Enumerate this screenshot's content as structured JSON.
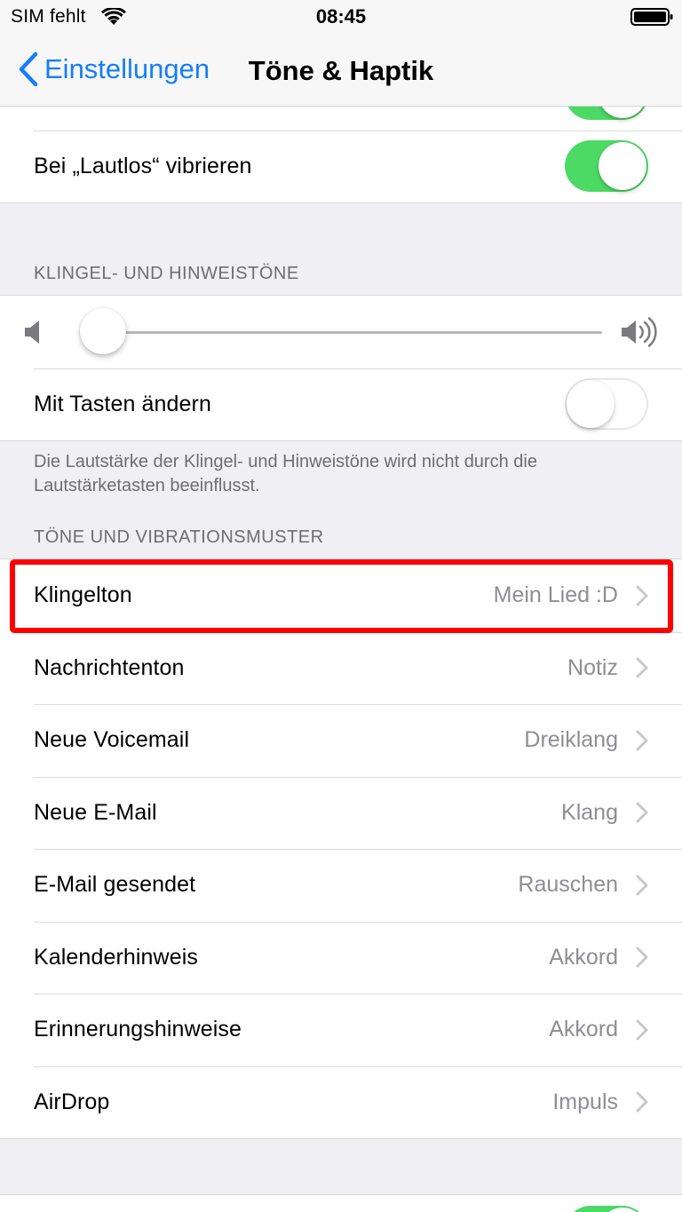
{
  "status_bar": {
    "carrier": "SIM fehlt",
    "time": "08:45"
  },
  "nav": {
    "back_label": "Einstellungen",
    "title": "Töne & Haptik"
  },
  "top_group": {
    "partial_row_toggle": "on",
    "vibrate_silent": {
      "label": "Bei „Lautlos“ vibrieren",
      "toggle": "on"
    }
  },
  "ringer_section": {
    "header": "KLINGEL- UND HINWEISTÖNE",
    "volume_level": 0.0,
    "change_with_buttons": {
      "label": "Mit Tasten ändern",
      "toggle": "off"
    },
    "footer": "Die Lautstärke der Klingel- und Hinweistöne wird nicht durch die Lautstärketasten beeinflusst."
  },
  "tones_section": {
    "header": "TÖNE UND VIBRATIONSMUSTER",
    "rows": [
      {
        "label": "Klingelton",
        "value": "Mein Lied :D"
      },
      {
        "label": "Nachrichtenton",
        "value": "Notiz"
      },
      {
        "label": "Neue Voicemail",
        "value": "Dreiklang"
      },
      {
        "label": "Neue E-Mail",
        "value": "Klang"
      },
      {
        "label": "E-Mail gesendet",
        "value": "Rauschen"
      },
      {
        "label": "Kalenderhinweis",
        "value": "Akkord"
      },
      {
        "label": "Erinnerungshinweise",
        "value": "Akkord"
      },
      {
        "label": "AirDrop",
        "value": "Impuls"
      }
    ]
  },
  "bottom_group": {
    "partial_row_toggle": "on"
  },
  "colors": {
    "accent": "#157efb",
    "toggle_on": "#4cd964",
    "highlight": "#ff0000",
    "background": "#efeff4"
  }
}
